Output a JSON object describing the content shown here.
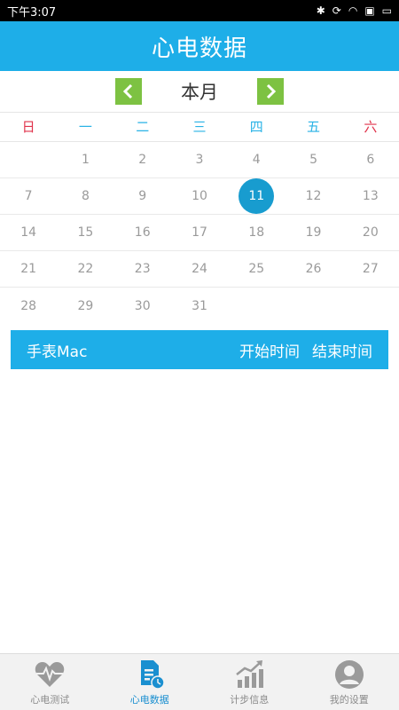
{
  "status": {
    "time": "下午3:07"
  },
  "header": {
    "title": "心电数据"
  },
  "month_nav": {
    "label": "本月",
    "prev_icon": "chevron-left-icon",
    "next_icon": "chevron-right-icon"
  },
  "weekdays": [
    "日",
    "一",
    "二",
    "三",
    "四",
    "五",
    "六"
  ],
  "calendar": {
    "rows": [
      [
        "",
        "1",
        "2",
        "3",
        "4",
        "5",
        "6"
      ],
      [
        "7",
        "8",
        "9",
        "10",
        "11",
        "12",
        "13"
      ],
      [
        "14",
        "15",
        "16",
        "17",
        "18",
        "19",
        "20"
      ],
      [
        "21",
        "22",
        "23",
        "24",
        "25",
        "26",
        "27"
      ],
      [
        "28",
        "29",
        "30",
        "31",
        "",
        "",
        ""
      ]
    ],
    "selected": "11"
  },
  "table_header": {
    "mac": "手表Mac",
    "start": "开始时间",
    "end": "结束时间"
  },
  "tabs": [
    {
      "label": "心电测试",
      "icon": "heart-pulse-icon"
    },
    {
      "label": "心电数据",
      "icon": "document-clock-icon"
    },
    {
      "label": "计步信息",
      "icon": "bar-chart-icon"
    },
    {
      "label": "我的设置",
      "icon": "user-avatar-icon"
    }
  ],
  "colors": {
    "primary": "#1eaee8",
    "nav_green": "#7dc242",
    "weekend_red": "#e0334b",
    "active_tab": "#1a8fd0"
  }
}
